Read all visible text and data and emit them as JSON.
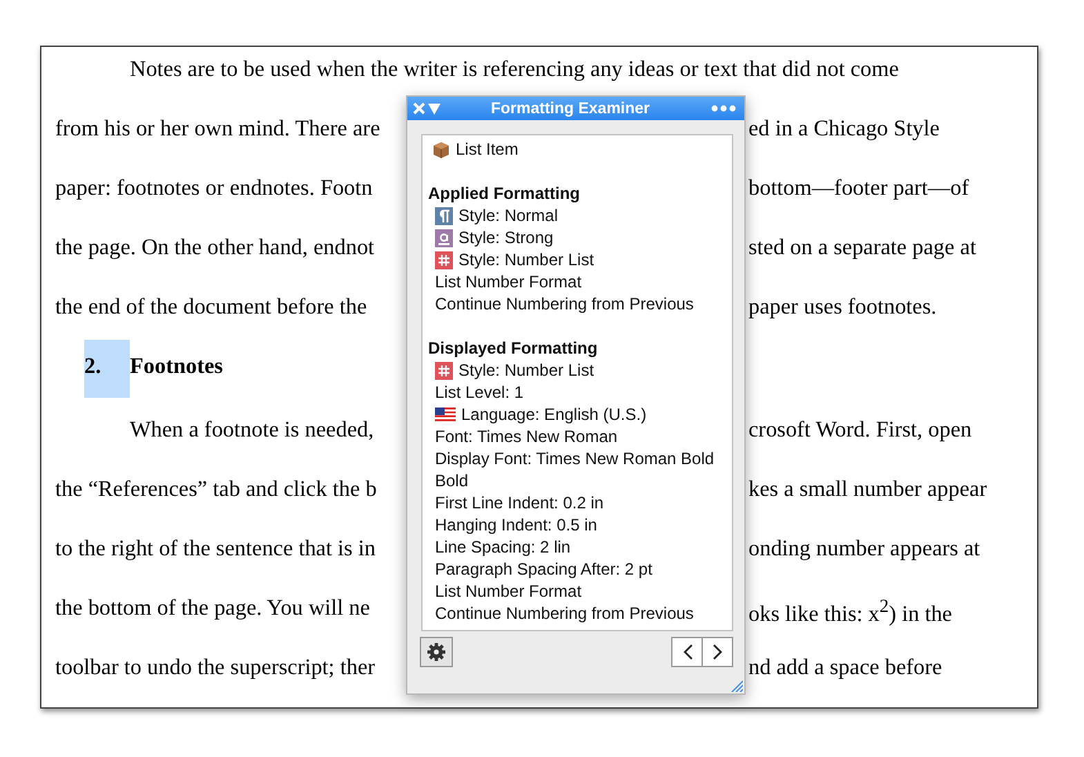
{
  "document": {
    "lines": [
      {
        "kind": "indent",
        "left": "Notes are to be used when the writer is referencing any ideas or text that did not come"
      },
      {
        "kind": "plain",
        "left": "from his or her own mind. There are",
        "right": "ed in a Chicago Style"
      },
      {
        "kind": "plain",
        "left": "paper: footnotes or endnotes. Footn",
        "right": "bottom—footer part—of"
      },
      {
        "kind": "plain",
        "left": "the page. On the other hand, endnot",
        "right": "sted on a separate page at"
      },
      {
        "kind": "plain",
        "left": "the end of the document before the",
        "right": "paper uses footnotes."
      },
      {
        "kind": "heading",
        "number": "2.",
        "selected": true,
        "left": "Footnotes"
      },
      {
        "kind": "indent",
        "left": "When a footnote is needed,",
        "right": "crosoft Word. First, open"
      },
      {
        "kind": "plain",
        "left": "the “References” tab and click the b",
        "right": "kes a small number appear"
      },
      {
        "kind": "plain",
        "left": "to the right of the sentence that is in",
        "right": "onding number appears at"
      },
      {
        "kind": "plain",
        "left": "the bottom of the page. You will ne",
        "right": "oks like this: x$^{2}$) in the"
      },
      {
        "kind": "plain",
        "left": "toolbar to undo the superscript; ther",
        "right": "nd add a space before"
      }
    ]
  },
  "panel": {
    "title": "Formatting Examiner",
    "rows": [
      {
        "kind": "box",
        "text": "List Item"
      },
      {
        "kind": "gap"
      },
      {
        "kind": "heading",
        "text": "Applied Formatting"
      },
      {
        "kind": "paragraph",
        "text": "Style: Normal"
      },
      {
        "kind": "character",
        "text": "Style: Strong"
      },
      {
        "kind": "list",
        "text": "Style: Number List"
      },
      {
        "kind": "plain",
        "text": "List Number Format"
      },
      {
        "kind": "plain",
        "text": "Continue Numbering from Previous"
      },
      {
        "kind": "gap"
      },
      {
        "kind": "heading",
        "text": "Displayed Formatting"
      },
      {
        "kind": "list",
        "text": "Style: Number List"
      },
      {
        "kind": "plain",
        "text": "List Level: 1"
      },
      {
        "kind": "flag",
        "text": "Language: English (U.S.)"
      },
      {
        "kind": "plain",
        "text": "Font: Times New Roman"
      },
      {
        "kind": "plain",
        "text": "Display Font: Times New Roman Bold"
      },
      {
        "kind": "plain",
        "text": "Bold"
      },
      {
        "kind": "plain",
        "text": "First Line Indent: 0.2 in"
      },
      {
        "kind": "plain",
        "text": "Hanging Indent: 0.5 in"
      },
      {
        "kind": "plain",
        "text": "Line Spacing: 2 lin"
      },
      {
        "kind": "plain",
        "text": "Paragraph Spacing After: 2 pt"
      },
      {
        "kind": "plain",
        "text": "List Number Format"
      },
      {
        "kind": "plain",
        "text": "Continue Numbering from Previous"
      }
    ]
  }
}
